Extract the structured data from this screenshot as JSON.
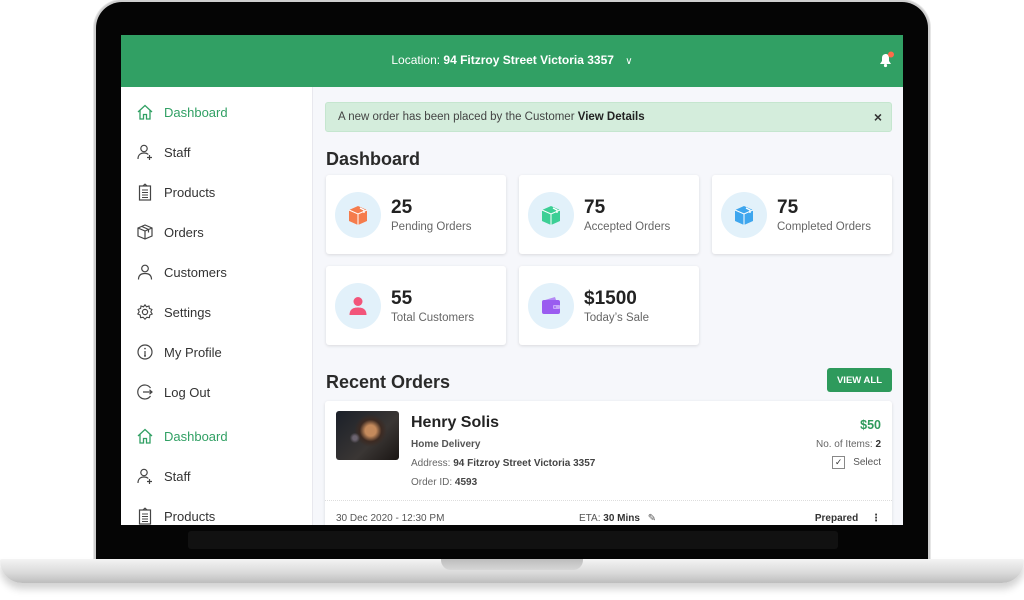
{
  "topbar": {
    "location_prefix": "Location:",
    "location_value": "94 Fitzroy Street Victoria 3357",
    "dropdown_icon": "chevron-down-icon",
    "bell_icon": "bell-icon",
    "notification_dot_color": "#ff6b4a"
  },
  "sidebar": {
    "items": [
      {
        "label": "Dashboard",
        "icon": "home-icon",
        "active": true
      },
      {
        "label": "Staff",
        "icon": "add-user-icon",
        "active": false
      },
      {
        "label": "Products",
        "icon": "clipboard-icon",
        "active": false
      },
      {
        "label": "Orders",
        "icon": "box-icon",
        "active": false
      },
      {
        "label": "Customers",
        "icon": "user-icon",
        "active": false
      },
      {
        "label": "Settings",
        "icon": "gear-icon",
        "active": false
      },
      {
        "label": "My Profile",
        "icon": "info-icon",
        "active": false
      },
      {
        "label": "Log Out",
        "icon": "logout-icon",
        "active": false
      },
      {
        "label": "Dashboard",
        "icon": "home-icon",
        "active": true
      },
      {
        "label": "Staff",
        "icon": "add-user-icon",
        "active": false
      },
      {
        "label": "Products",
        "icon": "clipboard-icon",
        "active": false
      }
    ]
  },
  "alert": {
    "message": "A new order has been placed by the Customer",
    "link": "View Details",
    "close": "×"
  },
  "dashboard": {
    "title": "Dashboard",
    "stats": [
      {
        "value": "25",
        "label": "Pending Orders",
        "icon": "box-icon",
        "color": "#f57c4c"
      },
      {
        "value": "75",
        "label": "Accepted Orders",
        "icon": "box-icon",
        "color": "#3ccf95"
      },
      {
        "value": "75",
        "label": "Completed Orders",
        "icon": "box-icon",
        "color": "#3ea6ee"
      },
      {
        "value": "55",
        "label": "Total Customers",
        "icon": "user-icon",
        "color": "#f2557a"
      },
      {
        "value": "$1500",
        "label": "Today’s Sale",
        "icon": "wallet-icon",
        "color": "#9a5cf0"
      }
    ]
  },
  "recent_orders": {
    "title": "Recent Orders",
    "view_all": "VIEW ALL",
    "orders": [
      {
        "customer": "Henry Solis",
        "type": "Home Delivery",
        "address_label": "Address:",
        "address": "94 Fitzroy Street Victoria 3357",
        "order_id_label": "Order ID:",
        "order_id": "4593",
        "price": "$50",
        "items_label": "No. of Items:",
        "items": "2",
        "select_label": "Select",
        "selected": true,
        "datetime": "30 Dec 2020 - 12:30 PM",
        "eta_label": "ETA:",
        "eta": "30 Mins",
        "status": "Prepared"
      }
    ]
  },
  "colors": {
    "brand": "#31a064",
    "alert_bg": "#d4eddc",
    "accent_price": "#2e9a5c"
  }
}
